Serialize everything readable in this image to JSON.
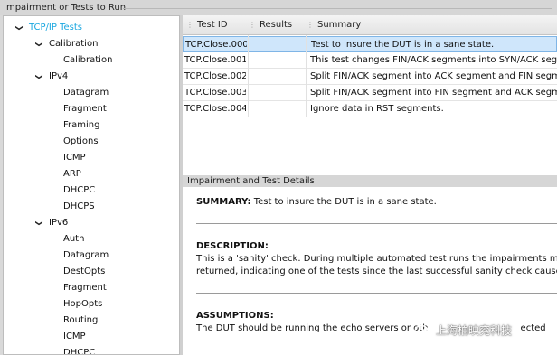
{
  "window": {
    "title": "Impairment or Tests to Run"
  },
  "tree": {
    "items": [
      {
        "label": "TCP/IP Tests",
        "level": 0,
        "expanded": true
      },
      {
        "label": "Calibration",
        "level": 1,
        "expanded": true
      },
      {
        "label": "Calibration",
        "level": 2
      },
      {
        "label": "IPv4",
        "level": 1,
        "expanded": true
      },
      {
        "label": "Datagram",
        "level": 2
      },
      {
        "label": "Fragment",
        "level": 2
      },
      {
        "label": "Framing",
        "level": 2
      },
      {
        "label": "Options",
        "level": 2
      },
      {
        "label": "ICMP",
        "level": 2
      },
      {
        "label": "ARP",
        "level": 2
      },
      {
        "label": "DHCPC",
        "level": 2
      },
      {
        "label": "DHCPS",
        "level": 2
      },
      {
        "label": "IPv6",
        "level": 1,
        "expanded": true
      },
      {
        "label": "Auth",
        "level": 2
      },
      {
        "label": "Datagram",
        "level": 2
      },
      {
        "label": "DestOpts",
        "level": 2
      },
      {
        "label": "Fragment",
        "level": 2
      },
      {
        "label": "HopOpts",
        "level": 2
      },
      {
        "label": "Routing",
        "level": 2
      },
      {
        "label": "ICMP",
        "level": 2
      },
      {
        "label": "DHCPC",
        "level": 2
      }
    ]
  },
  "table": {
    "columns": [
      "Test ID",
      "Results",
      "Summary"
    ],
    "rows": [
      {
        "id": "TCP.Close.000",
        "result": "",
        "summary": "Test to insure the DUT is in a sane state.",
        "selected": true
      },
      {
        "id": "TCP.Close.001",
        "result": "",
        "summary": "This test changes FIN/ACK segments into SYN/ACK segme"
      },
      {
        "id": "TCP.Close.002",
        "result": "",
        "summary": "Split FIN/ACK segment into ACK segment and FIN segme"
      },
      {
        "id": "TCP.Close.003",
        "result": "",
        "summary": "Split FIN/ACK segment into FIN segment and ACK segme"
      },
      {
        "id": "TCP.Close.004",
        "result": "",
        "summary": "Ignore data in RST segments."
      }
    ]
  },
  "details": {
    "title": "Impairment and Test Details",
    "summary_label": "SUMMARY:",
    "summary_text": "Test to insure the DUT is in a sane state.",
    "description_label": "DESCRIPTION:",
    "description_line1": "This is a 'sanity' check. During multiple automated test runs the impairments may cau",
    "description_line2": "returned, indicating one of the tests since the last successful sanity check caused th",
    "assumptions_label": "ASSUMPTIONS:",
    "assumptions_line1": "The DUT should be running the echo servers or oth",
    "assumptions_line1_tail": "ected"
  },
  "watermark": {
    "text": "上海柏映兖科技",
    "icon": "wechat-icon"
  },
  "colors": {
    "root_label": "#1aa7e0",
    "selection_bg": "#cfe6fb",
    "selection_border": "#7fb5e6"
  }
}
